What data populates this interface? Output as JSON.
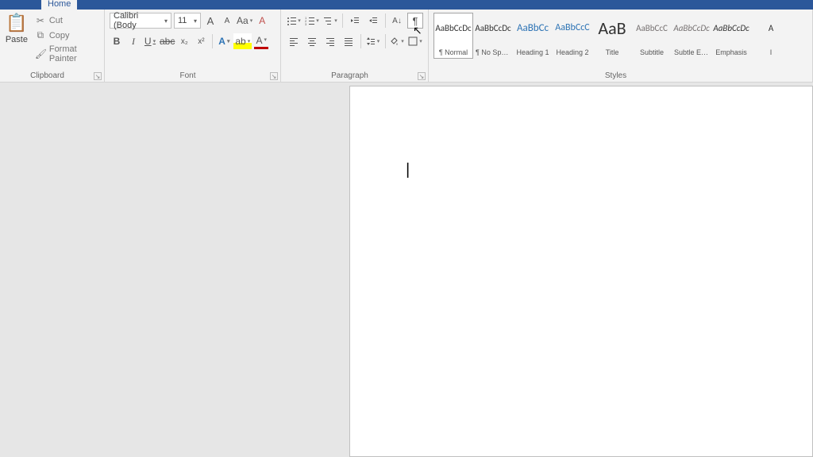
{
  "tabs": {
    "active": "Home"
  },
  "clipboard": {
    "group_label": "Clipboard",
    "paste_label": "Paste",
    "cut_label": "Cut",
    "copy_label": "Copy",
    "format_painter_label": "Format Painter"
  },
  "font": {
    "group_label": "Font",
    "name": "Calibri (Body",
    "size": "11",
    "grow": "A",
    "shrink": "A",
    "case": "Aa",
    "clear": "A",
    "bold": "B",
    "italic": "I",
    "underline": "U",
    "strike": "abc",
    "sub": "x₂",
    "sup": "x²",
    "text_effects": "A",
    "highlight": "ab",
    "font_color": "A"
  },
  "paragraph": {
    "group_label": "Paragraph",
    "sort": "A↓",
    "showmarks": "¶"
  },
  "styles": {
    "group_label": "Styles",
    "items": [
      {
        "preview": "AaBbCcDc",
        "name": "¶ Normal",
        "selected": true,
        "color": "#333",
        "size": "11px"
      },
      {
        "preview": "AaBbCcDc",
        "name": "¶ No Spac…",
        "color": "#333",
        "size": "11px"
      },
      {
        "preview": "AaBbCc",
        "name": "Heading 1",
        "color": "#2e74b5",
        "size": "13px"
      },
      {
        "preview": "AaBbCcC",
        "name": "Heading 2",
        "color": "#2e74b5",
        "size": "12px"
      },
      {
        "preview": "AaB",
        "name": "Title",
        "color": "#333",
        "size": "22px"
      },
      {
        "preview": "AaBbCcC",
        "name": "Subtitle",
        "color": "#767171",
        "size": "11px"
      },
      {
        "preview": "AaBbCcDc",
        "name": "Subtle Em…",
        "color": "#767171",
        "size": "11px",
        "italic": true
      },
      {
        "preview": "AaBbCcDc",
        "name": "Emphasis",
        "color": "#333",
        "size": "11px",
        "italic": true
      },
      {
        "preview": "A",
        "name": "I",
        "color": "#333",
        "size": "11px"
      }
    ]
  }
}
